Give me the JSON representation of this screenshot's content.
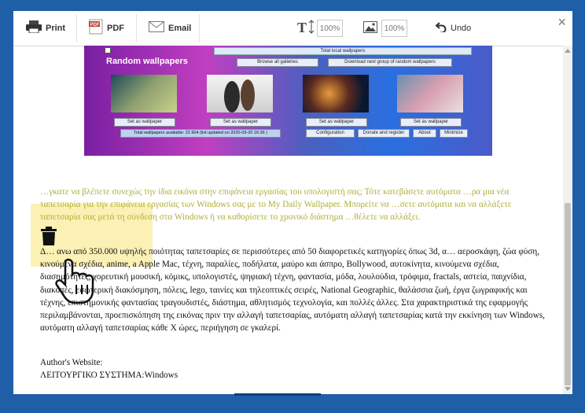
{
  "toolbar": {
    "print_label": "Print",
    "pdf_label": "PDF",
    "email_label": "Email",
    "text_size_value": "100%",
    "image_size_value": "100%",
    "undo_label": "Undo",
    "close_label": "×"
  },
  "screenshot": {
    "topbar": "Total local wallpapers",
    "browse_all": "Browse all galleries",
    "download_next": "Download next group of random wallpapers",
    "title": "Random wallpapers",
    "set_as_wallpaper": "Set as wallpaper",
    "total_available": "Total wallpapers available: 22.904 (list updated on 2020-09-20 16:36 )",
    "configuration": "Configuration",
    "donate": "Donate and register",
    "about": "About",
    "minimize": "Minimize"
  },
  "article": {
    "faded_paragraph": "…γκατε να βλέπετε συνεχώς την ίδια εικόνα στην επιφάνεια εργασίας του υπολογιστή σας; Τότε κατεβάσετε αυτόματα …ρα μια νέα ταπετσαρία για την επιφάνεια εργασίας των Windows σας με το My Daily Wallpaper. Μπορείτε να …σετε αυτόματα και να αλλάξετε ταπετσαρία σας μετά τη σύνδεση στα Windows ή να καθορίσετε το χρονικό διάστημα …θέλετε να αλλάξει.",
    "main_paragraph": "Δ… ανω από 350.000 υψηλής ποιότητας ταπετσαρίες σε περισσότερες από 50 διαφορετικές κατηγορίες όπως 3d, α… αεροσκάφη, ζώα φύση, κινούμενα σχέδια, anime, a Apple Mac, τέχνη, παραλίες, ποδήλατα, μαύρο και άσπρο, Bollywood, αυτοκίνητα, κινούμενα σχέδια, διασημότητες, χορευτική μουσική, κόμικς, υπολογιστές, ψηφιακή τέχνη, φαντασία, μόδα, λουλούδια, τρόφιμα, fractals, αστεία, παιχνίδια, διακοπές, εσωτερική διακόσμηση, πόλεις, lego, ταινίες και τηλεοπτικές σειρές, National Geographic, θαλάσσια ζωή, έργα ζωγραφικής και τέχνης, επιστημονικής φαντασίας τραγουδιστές, διάστημα, αθλητισμός τεχνολογία, και πολλές άλλες. Στα χαρακτηριστικά της εφαρμογής περιλαμβάνονται, προεπισκόπηση της εικόνας πριν την αλλαγή ταπετσαρίας, αυτόματη αλλαγή ταπετσαρίας κατά την εκκίνηση των Windows, αυτόματη αλλαγή ταπετσαρίας κάθε Χ ώρες, περιήγηση σε γκαλερί.",
    "author_label": "Author's Website:",
    "os_label": "ΛΕΙΤΟΥΡΓΙΚΟ ΣΥΣΤΗΜΑ:Windows"
  }
}
